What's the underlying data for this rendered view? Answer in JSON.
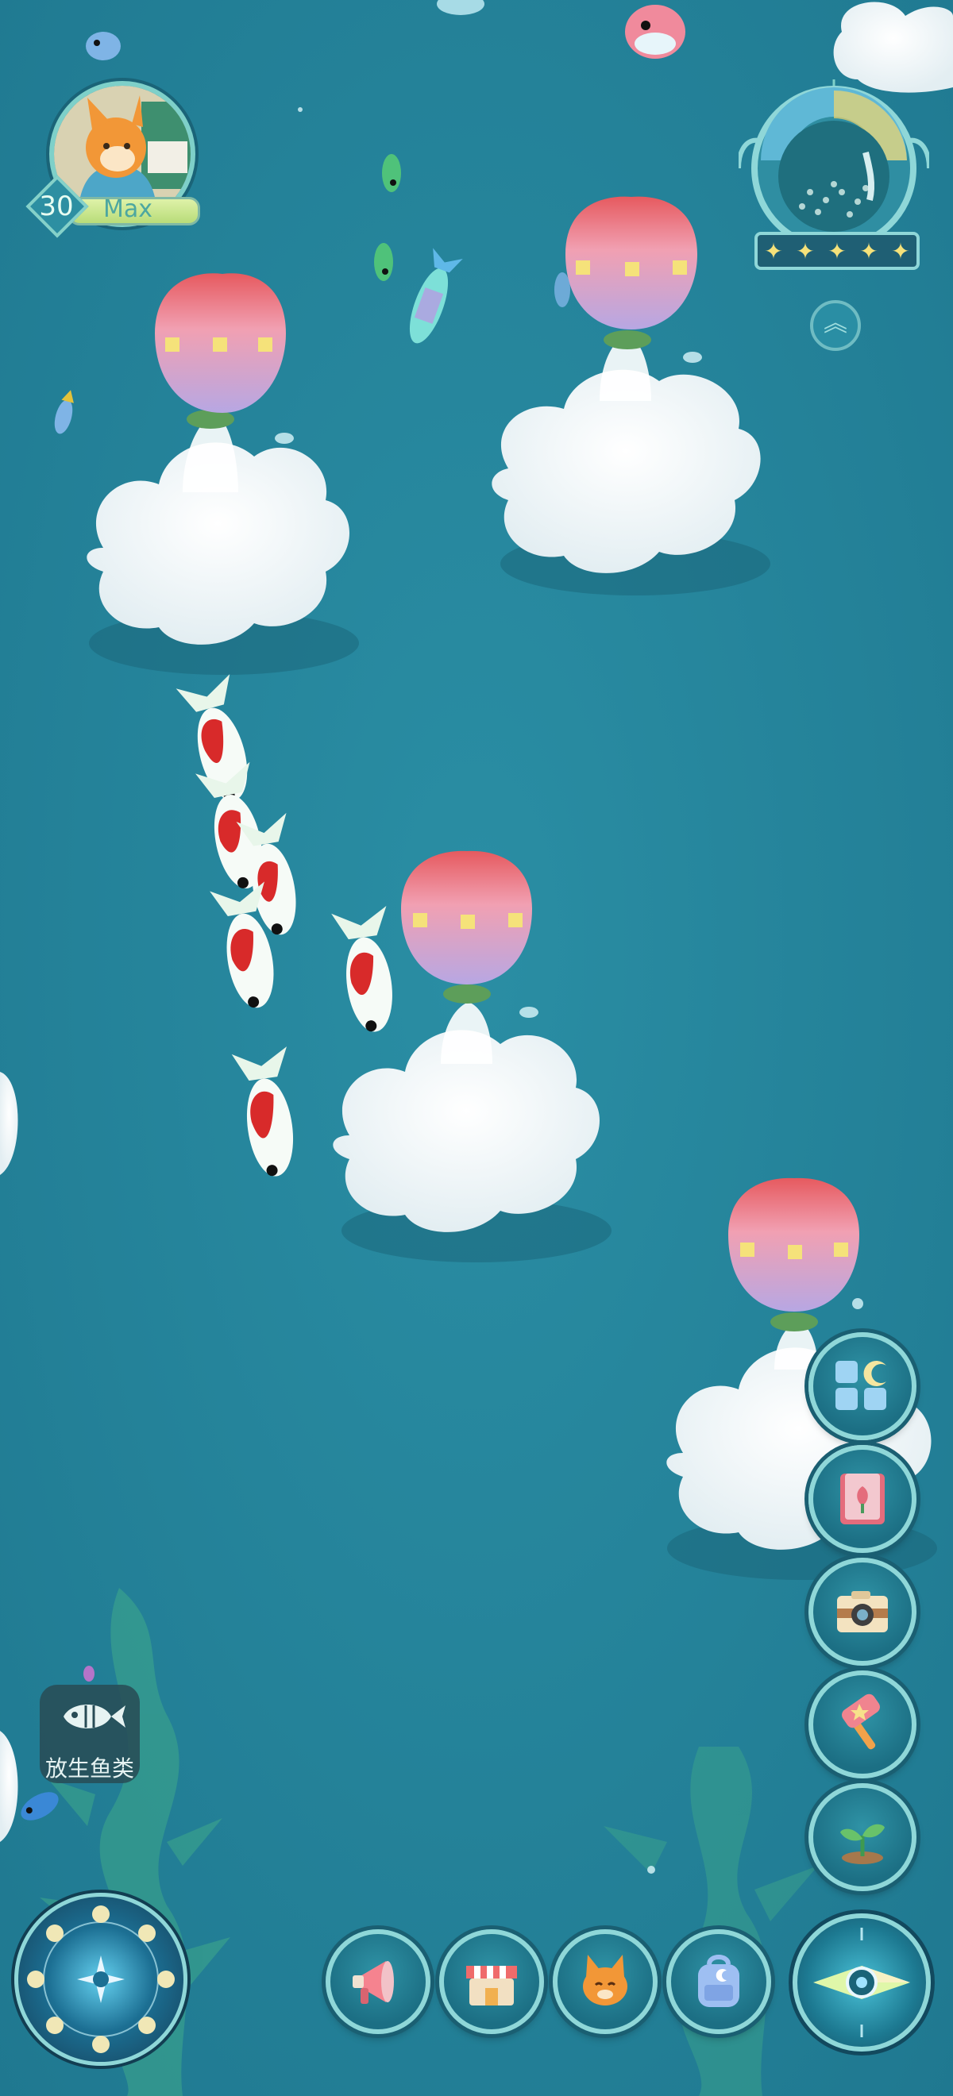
{
  "player": {
    "level": "30",
    "level_status": "Max"
  },
  "star_rating": {
    "stars": 5,
    "filled": 5
  },
  "release_fish": {
    "label": "放生鱼类"
  },
  "side_menu": [
    {
      "icon": "gallery-grid-icon"
    },
    {
      "icon": "book-icon"
    },
    {
      "icon": "camera-icon"
    },
    {
      "icon": "hammer-icon"
    },
    {
      "icon": "sprout-icon"
    }
  ],
  "bottom_bar": [
    {
      "icon": "megaphone-icon"
    },
    {
      "icon": "shop-icon"
    },
    {
      "icon": "fox-icon"
    },
    {
      "icon": "backpack-icon"
    }
  ],
  "colors": {
    "water": "#25859c",
    "button_ring": "#8fd7d8",
    "level_bar": "#c6e38b",
    "star": "#f5e27a"
  }
}
